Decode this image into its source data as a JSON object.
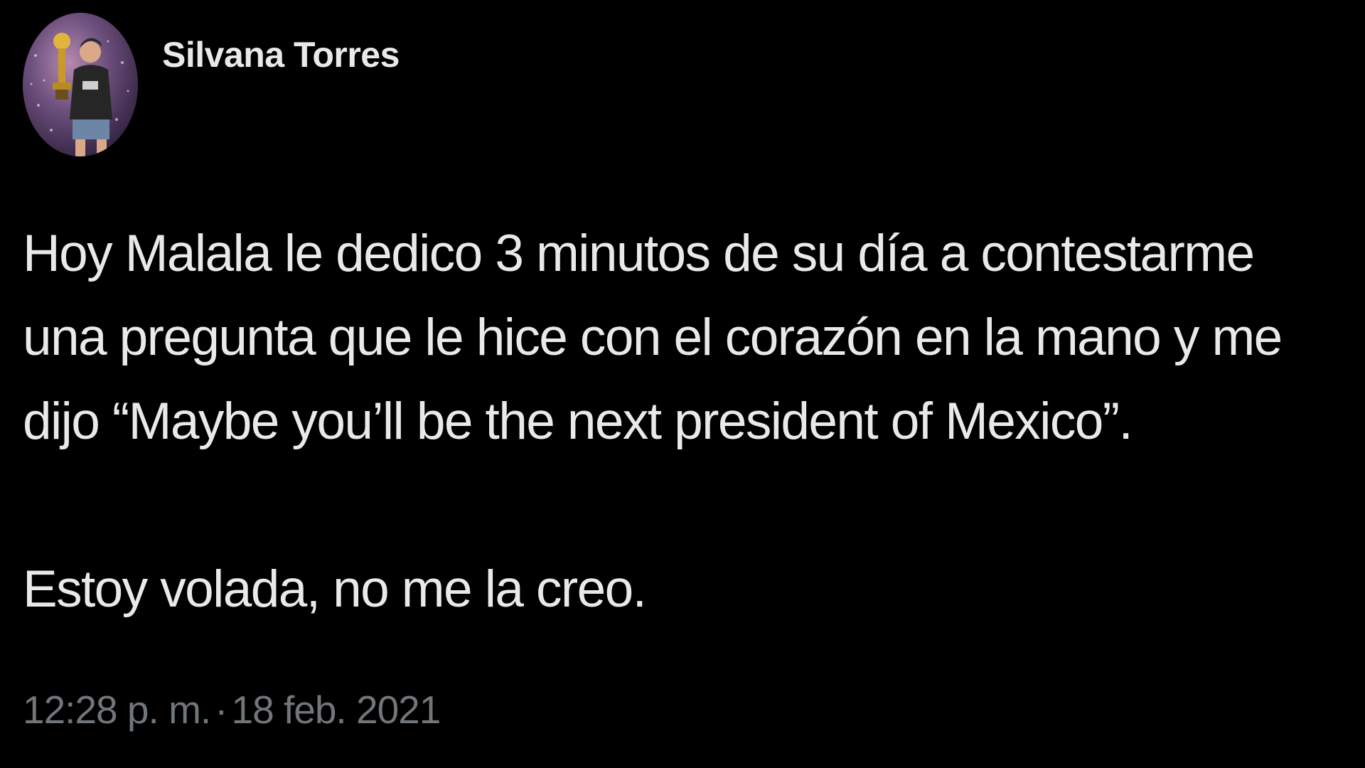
{
  "tweet": {
    "author": {
      "display_name": "Silvana Torres"
    },
    "body": {
      "paragraph1": "Hoy Malala le dedico 3 minutos de su día a contestarme una pregunta que le hice con el corazón en la mano y me dijo “Maybe you’ll be the next president of Mexico”.",
      "paragraph2": "Estoy volada, no me la creo."
    },
    "meta": {
      "time": "12:28 p. m.",
      "separator": "·",
      "date": "18 feb. 2021"
    }
  },
  "colors": {
    "background": "#000000",
    "text_primary": "#e7e9ea",
    "text_secondary": "#71767b"
  }
}
